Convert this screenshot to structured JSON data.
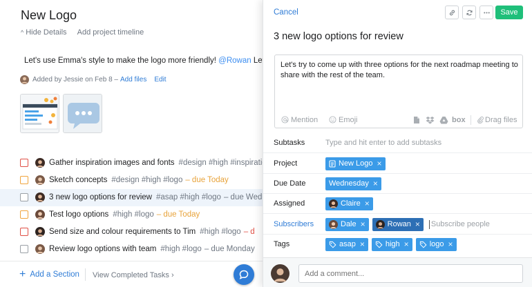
{
  "project": {
    "title": "New Logo",
    "hide_details": "Hide Details",
    "add_timeline": "Add project timeline",
    "desc_text": "Let's use Emma's style to make the logo more friendly! ",
    "desc_mention": "@Rowan",
    "desc_tail": " Let's ju",
    "added_by": "Added by Jessie on Feb 8 –",
    "add_files": "Add files",
    "edit": "Edit"
  },
  "tasks": [
    {
      "name": "Gather inspiration images and fonts",
      "tags": "#design #high #inspiratio",
      "due": "",
      "checkbox": "red"
    },
    {
      "name": "Sketch concepts",
      "tags": "#design #high #logo",
      "due": "– due Today",
      "due_color": "orange",
      "checkbox": "orange"
    },
    {
      "name": "3 new logo options for review",
      "tags": "#asap #high #logo",
      "due": "– due Wedn",
      "due_color": "gray",
      "checkbox": "gray"
    },
    {
      "name": "Test logo options",
      "tags": "#high #logo",
      "due": "– due Today",
      "due_color": "orange",
      "checkbox": "orange"
    },
    {
      "name": "Send size and colour requirements to Tim",
      "tags": "#high #logo",
      "due": "– d",
      "due_color": "red",
      "checkbox": "red"
    },
    {
      "name": "Review logo options with team",
      "tags": "#high #logo",
      "due": "– due Monday",
      "due_color": "gray",
      "checkbox": "gray"
    }
  ],
  "bottom": {
    "add_section": "Add a Section",
    "view_completed": "View Completed Tasks"
  },
  "detail": {
    "cancel": "Cancel",
    "save": "Save",
    "title": "3 new logo options for review",
    "description": "Let's try to come up with three options for the next roadmap meeting to share with the rest of the team.",
    "mention": "Mention",
    "emoji": "Emoji",
    "box": "box",
    "drag_files": "Drag files",
    "fields": {
      "subtasks_label": "Subtasks",
      "subtasks_placeholder": "Type and hit enter to add subtasks",
      "project_label": "Project",
      "project_value": "New Logo",
      "due_label": "Due Date",
      "due_value": "Wednesday",
      "assigned_label": "Assigned",
      "assigned_value": "Claire",
      "subscribers_label": "Subscribers",
      "subscriber_1": "Dale",
      "subscriber_2": "Rowan",
      "subscribers_placeholder": "Subscribe people",
      "tags_label": "Tags",
      "tag_1": "asap",
      "tag_2": "high",
      "tag_3": "logo"
    },
    "comment_placeholder": "Add a comment..."
  },
  "colors": {
    "accent_blue": "#2f7cd6",
    "chip_blue": "#3b9be8",
    "save_green": "#1fbf7a",
    "due_orange": "#e8a33b",
    "due_red": "#e04f45"
  }
}
